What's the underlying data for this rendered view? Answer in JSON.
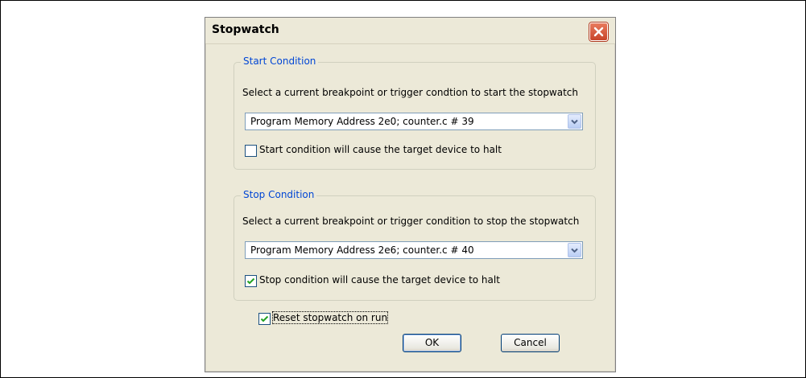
{
  "dialog": {
    "title": "Stopwatch"
  },
  "start_condition": {
    "group_title": "Start Condition",
    "description": "Select a current breakpoint or trigger condtion to start the stopwatch",
    "selected_value": "Program Memory Address 2e0; counter.c # 39",
    "halt_label": "Start condition will cause the target device to halt",
    "halt_checked": false
  },
  "stop_condition": {
    "group_title": "Stop Condition",
    "description": "Select a current breakpoint or trigger condition to stop the stopwatch",
    "selected_value": "Program Memory Address 2e6; counter.c # 40",
    "halt_label": "Stop condition will cause the target device to halt",
    "halt_checked": true
  },
  "reset_option": {
    "label": "Reset stopwatch on run",
    "checked": true
  },
  "buttons": {
    "ok_label": "OK",
    "cancel_label": "Cancel"
  },
  "icons": {
    "close": "close-x-icon",
    "dropdown": "chevron-down-icon",
    "check": "checkmark-icon"
  },
  "colors": {
    "dialog_bg": "#ece9d8",
    "group_title": "#0046d5",
    "close_button": "#c8452a",
    "checkmark": "#21a121"
  }
}
